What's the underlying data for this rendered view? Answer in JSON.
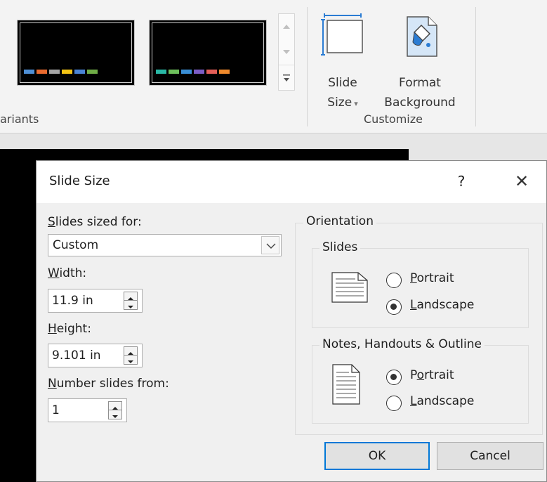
{
  "ribbon": {
    "variants": {
      "label": "ariants",
      "thumbnail_1_swatch_colors": [
        "#4f8fd5",
        "#e96b2f",
        "#a5a5a5",
        "#f2c314",
        "#4a84d6",
        "#70ad47"
      ],
      "thumbnail_2_swatch_colors": [
        "#29b8a6",
        "#6ec05c",
        "#3a8fd6",
        "#7c5dc6",
        "#e45f58",
        "#f08a2c"
      ]
    },
    "customize": {
      "slide_size_label_line1": "Slide",
      "slide_size_label_line2": "Size",
      "slide_size_dropdown_glyph": "▾",
      "format_background_label_line1": "Format",
      "format_background_label_line2": "Background",
      "group_label": "Customize"
    }
  },
  "dialog": {
    "title": "Slide Size",
    "help_glyph": "?",
    "close_glyph": "✕",
    "sized_for": {
      "label_first": "S",
      "label_rest": "lides sized for:",
      "value": "Custom"
    },
    "width": {
      "label_first": "W",
      "label_rest": "idth:",
      "value": "11.9 in"
    },
    "height": {
      "label_first": "H",
      "label_rest": "eight:",
      "value": "9.101 in"
    },
    "number_from": {
      "label_first": "N",
      "label_rest": "umber slides from:",
      "value": "1"
    },
    "orientation": {
      "title": "Orientation",
      "slides": {
        "title": "Slides",
        "portrait_first": "P",
        "portrait_rest": "ortrait",
        "landscape_first": "L",
        "landscape_rest": "andscape",
        "selected": "landscape"
      },
      "notes": {
        "title": "Notes, Handouts & Outline",
        "portrait_pre": "P",
        "portrait_u": "o",
        "portrait_post": "rtrait",
        "landscape_first": "L",
        "landscape_rest": "andscape",
        "selected": "portrait"
      }
    },
    "ok_label": "OK",
    "cancel_label": "Cancel"
  }
}
